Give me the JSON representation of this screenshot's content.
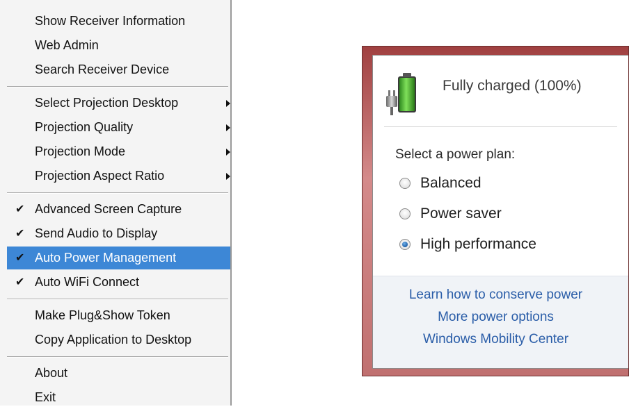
{
  "menu": {
    "groups": [
      [
        {
          "label": "Show Receiver Information"
        },
        {
          "label": "Web Admin"
        },
        {
          "label": "Search Receiver Device"
        }
      ],
      [
        {
          "label": "Select Projection Desktop"
        },
        {
          "label": "Projection Quality"
        },
        {
          "label": "Projection Mode"
        },
        {
          "label": "Projection Aspect Ratio"
        }
      ],
      [
        {
          "label": "Advanced Screen Capture",
          "check": "✔"
        },
        {
          "label": "Send Audio to Display",
          "check": "✔"
        },
        {
          "label": "Auto Power Management",
          "check": "✔"
        },
        {
          "label": "Auto WiFi Connect",
          "check": "✔"
        }
      ],
      [
        {
          "label": "Make Plug&Show Token"
        },
        {
          "label": "Copy Application to Desktop"
        }
      ],
      [
        {
          "label": "About"
        },
        {
          "label": "Exit"
        }
      ]
    ],
    "highlight_color": "#3d87d6"
  },
  "power": {
    "status": "Fully charged (100%)",
    "battery_icon": "battery-plug-icon",
    "battery_level": 1.0,
    "plan_heading": "Select a power plan:",
    "plans": [
      {
        "label": "Balanced"
      },
      {
        "label": "Power saver"
      },
      {
        "label": "High performance"
      }
    ],
    "selected_plan": "High performance",
    "links": [
      "Learn how to conserve power",
      "More power options",
      "Windows Mobility Center"
    ],
    "link_color": "#2a5da8"
  }
}
